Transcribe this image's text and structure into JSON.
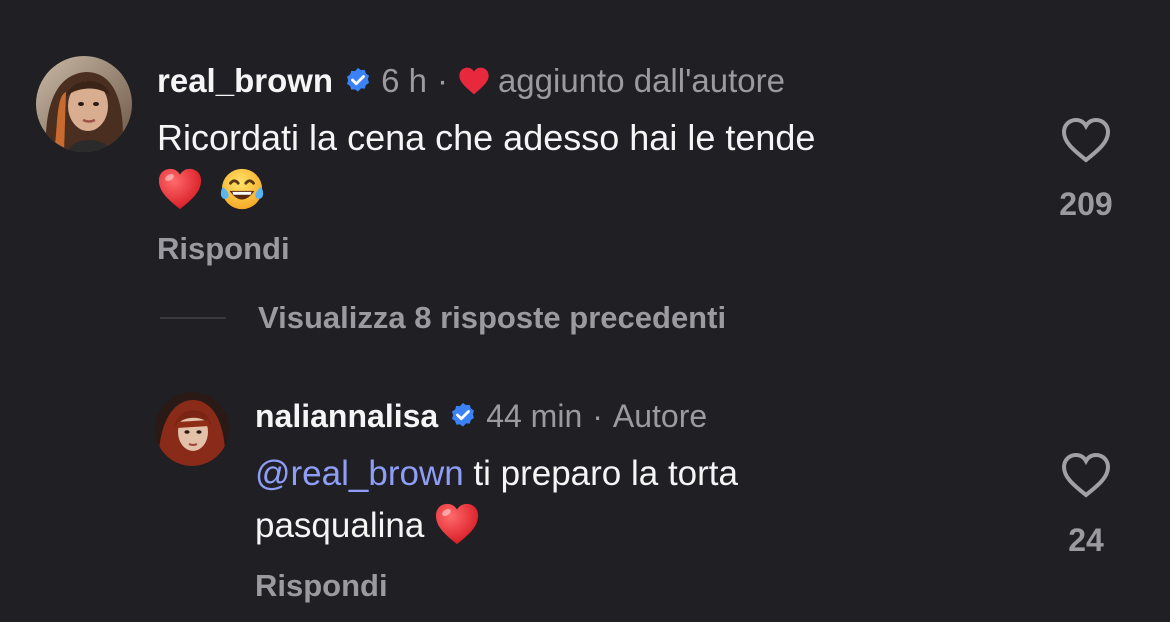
{
  "comments": [
    {
      "username": "real_brown",
      "time": "6 h",
      "separator": "·",
      "liked_by_author_label": "aggiunto dall'autore",
      "text": "Ricordati la cena che adesso hai le tende",
      "emojis": [
        "red-heart-emoji",
        "tears-of-joy-emoji"
      ],
      "reply_label": "Rispondi",
      "like_count": "209"
    },
    {
      "username": "naliannalisa",
      "time": "44 min",
      "separator": "·",
      "author_label": "Autore",
      "mention": "@real_brown",
      "text_line1": " ti preparo la torta",
      "text_line2": "pasqualina ",
      "emojis": [
        "red-heart-emoji"
      ],
      "reply_label": "Rispondi",
      "like_count": "24"
    }
  ],
  "view_replies_label": "Visualizza 8 risposte precedenti",
  "colors": {
    "background": "#1f1f24",
    "secondary_text": "#9a9aa0",
    "mention": "#8e9df5",
    "verified": "#3b82f6",
    "heart_red": "#e8283d"
  }
}
